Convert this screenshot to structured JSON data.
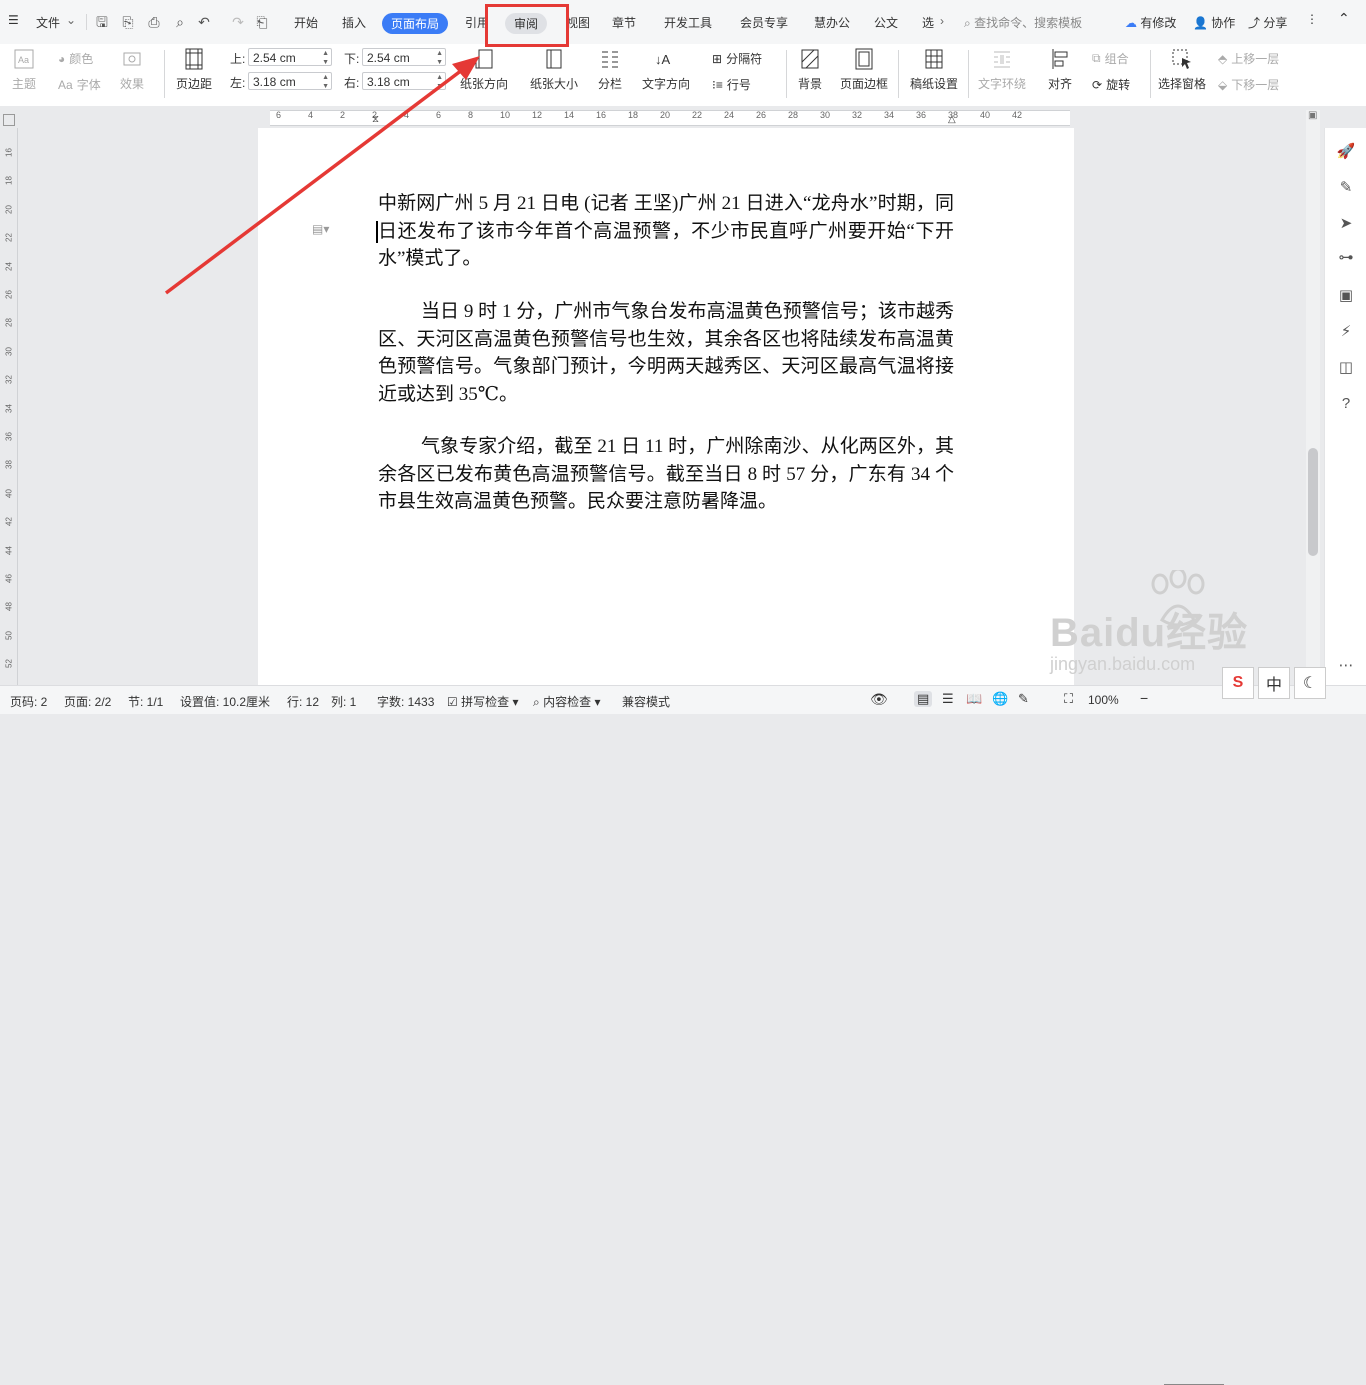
{
  "menubar": {
    "file_label": "文件",
    "tabs": [
      {
        "label": "开始"
      },
      {
        "label": "插入"
      },
      {
        "label": "页面布局",
        "active": true
      },
      {
        "label": "引用"
      },
      {
        "label": "审阅",
        "highlighted": true
      },
      {
        "label": "视图"
      },
      {
        "label": "章节"
      },
      {
        "label": "开发工具"
      },
      {
        "label": "会员专享"
      },
      {
        "label": "慧办公"
      },
      {
        "label": "公文"
      },
      {
        "label": "选"
      }
    ],
    "more_glyph": "›",
    "search_placeholder": "查找命令、搜索模板",
    "modified_label": "有修改",
    "collab_label": "协作",
    "share_label": "分享"
  },
  "ribbon": {
    "theme_label": "主题",
    "color_label": "颜色",
    "font_label": "字体",
    "effect_label": "效果",
    "margin_label": "页边距",
    "margin_top_label": "上:",
    "margin_top_value": "2.54 cm",
    "margin_bottom_label": "下:",
    "margin_bottom_value": "2.54 cm",
    "margin_left_label": "左:",
    "margin_left_value": "3.18 cm",
    "margin_right_label": "右:",
    "margin_right_value": "3.18 cm",
    "orientation_label": "纸张方向",
    "paper_size_label": "纸张大小",
    "columns_label": "分栏",
    "text_direction_label": "文字方向",
    "separator_label": "分隔符",
    "line_number_label": "行号",
    "background_label": "背景",
    "page_border_label": "页面边框",
    "manuscript_label": "稿纸设置",
    "text_wrap_label": "文字环绕",
    "align_label": "对齐",
    "group_label": "组合",
    "rotate_label": "旋转",
    "selection_pane_label": "选择窗格",
    "bring_forward_label": "上移一层",
    "send_backward_label": "下移一层"
  },
  "ruler": {
    "ticks": [
      "6",
      "4",
      "2",
      "2",
      "4",
      "6",
      "8",
      "10",
      "12",
      "14",
      "16",
      "18",
      "20",
      "22",
      "24",
      "26",
      "28",
      "30",
      "32",
      "34",
      "36",
      "38",
      "40",
      "42"
    ],
    "vticks": [
      "16",
      "18",
      "20",
      "22",
      "24",
      "26",
      "28",
      "30",
      "32",
      "34",
      "36",
      "38",
      "40",
      "42",
      "44",
      "46",
      "48",
      "50",
      "52"
    ]
  },
  "document": {
    "paragraphs": [
      "中新网广州 5 月 21 日电 (记者 王坚)广州 21 日进入“龙舟水”时期，同日还发布了该市今年首个高温预警，不少市民直呼广州要开始“下开水”模式了。",
      "当日 9 时 1 分，广州市气象台发布高温黄色预警信号；该市越秀区、天河区高温黄色预警信号也生效，其余各区也将陆续发布高温黄色预警信号。气象部门预计，今明两天越秀区、天河区最高气温将接近或达到 35℃。",
      "气象专家介绍，截至 21 日 11 时，广州除南沙、从化两区外，其余各区已发布黄色高温预警信号。截至当日 8 时 57 分，广东有 34 个市县生效高温黄色预警。民众要注意防暑降温。"
    ]
  },
  "statusbar": {
    "page_no": "页码: 2",
    "page_count": "页面: 2/2",
    "section": "节: 1/1",
    "setting_value": "设置值: 10.2厘米",
    "row": "行: 12",
    "col": "列: 1",
    "word_count": "字数: 1433",
    "spell_check": "拼写检查",
    "content_check": "内容检查",
    "compat_mode": "兼容模式",
    "zoom": "100%"
  },
  "ime": {
    "lang_label": "中"
  },
  "watermark": {
    "brand": "Baidu经验",
    "url": "jingyan.baidu.com"
  },
  "colors": {
    "accent": "#3b7cf6",
    "annotation_red": "#e53935"
  }
}
